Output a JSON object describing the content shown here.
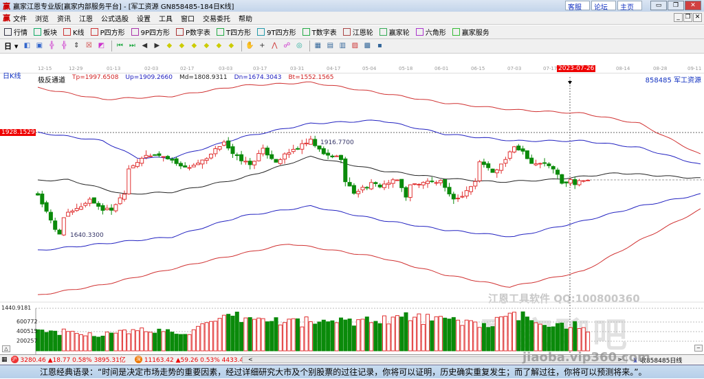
{
  "window": {
    "title": "赢家江恩专业版[赢家内部服务平台] - [军工资源  GN858485-184日K线]",
    "links": [
      "客服",
      "论坛",
      "主页"
    ],
    "logo": "赢"
  },
  "menu": [
    "文件",
    "浏览",
    "资讯",
    "江恩",
    "公式选股",
    "设置",
    "工具",
    "窗口",
    "交易委托",
    "帮助"
  ],
  "toolbar1": [
    {
      "label": "行情",
      "icon": "grid-icon",
      "color": "#334"
    },
    {
      "label": "板块",
      "icon": "blocks-icon",
      "color": "#1a6"
    },
    {
      "label": "K线",
      "icon": "candles-icon",
      "color": "#c33"
    },
    {
      "label": "P四方形",
      "icon": "p-square-icon",
      "color": "#c33"
    },
    {
      "label": "9P四方形",
      "icon": "9p-square-icon",
      "color": "#a3a"
    },
    {
      "label": "P数字表",
      "icon": "p-table-icon",
      "color": "#a33"
    },
    {
      "label": "T四方形",
      "icon": "t-square-icon",
      "color": "#2a4"
    },
    {
      "label": "9T四方形",
      "icon": "9t-square-icon",
      "color": "#29a"
    },
    {
      "label": "T数字表",
      "icon": "t-table-icon",
      "color": "#2a4"
    },
    {
      "label": "江恩轮",
      "icon": "gann-wheel-icon",
      "color": "#a44"
    },
    {
      "label": "赢家轮",
      "icon": "winner-wheel-icon",
      "color": "#3a5"
    },
    {
      "label": "六角形",
      "icon": "hexagon-icon",
      "color": "#a3c"
    },
    {
      "label": "赢家服务",
      "icon": "dollar-icon",
      "color": "#3b3"
    }
  ],
  "toolbar2": {
    "period": "日",
    "buttons": [
      "◧",
      "▣",
      "╬",
      "╬",
      "⇕",
      "☒",
      "◩",
      "⏮",
      "⏭",
      "◀",
      "▶",
      "◆",
      "◆",
      "◆",
      "◆",
      "◆",
      "◆",
      "✋",
      "+",
      "⋀",
      "☍",
      "◎",
      "▦",
      "▤",
      "▥",
      "▨",
      "▩",
      "▪"
    ]
  },
  "axis": {
    "ticks": [
      "12-15",
      "12-29",
      "01-13",
      "02-03",
      "02-17",
      "03-03",
      "03-17",
      "03-31",
      "04-17",
      "05-04",
      "05-18",
      "06-01",
      "06-15",
      "07-03",
      "07-17",
      "2023-07-26",
      "08-14",
      "08-28",
      "09-11"
    ]
  },
  "header": {
    "period": "日K线",
    "indicator": "极反通道",
    "tp": "Tp=1997.6508",
    "up": "Up=1909.2660",
    "md": "Md=1808.9311",
    "dn": "Dn=1674.3043",
    "bt": "Bt=1552.1565",
    "code": "858485  军工资源"
  },
  "labels": {
    "cursor_price": "1928.1529",
    "high": "1916.7700",
    "low": "1640.3300",
    "bottom": "1440.9181",
    "vol": [
      "600772",
      "400515",
      "200257"
    ]
  },
  "watermark": {
    "line1": "江恩工具软件  QQ:100800360",
    "line2": "赢家聊吧",
    "line3": "jiaoba.vip360.com"
  },
  "status": {
    "sh": {
      "badge": "沪",
      "text": "3280.46 ▲18.77 0.58% 3895.31亿"
    },
    "sz": {
      "badge": "深",
      "text": "11163.42 ▲59.26 0.53% 4433.45亿"
    },
    "right": "收858485日线"
  },
  "quote": "江恩经典语录：“时间是决定市场走势的重要因素，经过详细研究大市及个别股票的过往记录，你将可以证明，历史确实重复发生；而了解过往，你将可以预测将来。”。",
  "colors": {
    "up": "#e03030",
    "down": "#0a8a0a",
    "band_outer": "#d03030",
    "band_inner": "#2020c0",
    "mid": "#222222"
  },
  "chart_data": {
    "type": "candlestick",
    "title": "军工资源 日K线",
    "candles": 128,
    "close_keypoints": [
      [
        0,
        1756
      ],
      [
        4,
        1658
      ],
      [
        5,
        1648
      ],
      [
        6,
        1696
      ],
      [
        9,
        1715
      ],
      [
        12,
        1743
      ],
      [
        15,
        1715
      ],
      [
        17,
        1715
      ],
      [
        20,
        1762
      ],
      [
        21,
        1829
      ],
      [
        24,
        1858
      ],
      [
        28,
        1867
      ],
      [
        33,
        1839
      ],
      [
        34,
        1829
      ],
      [
        39,
        1853
      ],
      [
        43,
        1905
      ],
      [
        45,
        1867
      ],
      [
        49,
        1839
      ],
      [
        52,
        1880
      ],
      [
        55,
        1848
      ],
      [
        59,
        1880
      ],
      [
        63,
        1905
      ],
      [
        66,
        1867
      ],
      [
        70,
        1858
      ],
      [
        71,
        1791
      ],
      [
        73,
        1762
      ],
      [
        77,
        1785
      ],
      [
        79,
        1781
      ],
      [
        83,
        1796
      ],
      [
        85,
        1753
      ],
      [
        86,
        1781
      ],
      [
        89,
        1791
      ],
      [
        93,
        1791
      ],
      [
        95,
        1753
      ],
      [
        97,
        1743
      ],
      [
        101,
        1791
      ],
      [
        102,
        1848
      ],
      [
        105,
        1820
      ],
      [
        107,
        1839
      ],
      [
        110,
        1886
      ],
      [
        112,
        1877
      ],
      [
        114,
        1843
      ],
      [
        118,
        1839
      ],
      [
        120,
        1810
      ],
      [
        121,
        1785
      ],
      [
        123,
        1796
      ],
      [
        124,
        1785
      ],
      [
        127,
        1800
      ]
    ],
    "bands": {
      "tp": [
        [
          0,
          2052
        ],
        [
          15,
          2020
        ],
        [
          31,
          2029
        ],
        [
          47,
          2058
        ],
        [
          63,
          2067
        ],
        [
          79,
          2038
        ],
        [
          94,
          2010
        ],
        [
          110,
          1991
        ],
        [
          126,
          1981
        ],
        [
          139,
          1953
        ],
        [
          153,
          1867
        ]
      ],
      "up": [
        [
          0,
          1928
        ],
        [
          15,
          1905
        ],
        [
          23,
          1858
        ],
        [
          31,
          1858
        ],
        [
          47,
          1915
        ],
        [
          63,
          1953
        ],
        [
          79,
          1962
        ],
        [
          94,
          1924
        ],
        [
          110,
          1905
        ],
        [
          126,
          1905
        ],
        [
          139,
          1886
        ],
        [
          153,
          1839
        ]
      ],
      "md": [
        [
          0,
          1795
        ],
        [
          7,
          1797
        ],
        [
          20,
          1757
        ],
        [
          31,
          1763
        ],
        [
          47,
          1801
        ],
        [
          63,
          1861
        ],
        [
          79,
          1823
        ],
        [
          94,
          1801
        ],
        [
          106,
          1791
        ],
        [
          118,
          1797
        ],
        [
          134,
          1816
        ],
        [
          153,
          1801
        ]
      ],
      "dn": [
        [
          0,
          1601
        ],
        [
          15,
          1620
        ],
        [
          31,
          1639
        ],
        [
          47,
          1696
        ],
        [
          63,
          1724
        ],
        [
          79,
          1686
        ],
        [
          94,
          1658
        ],
        [
          110,
          1639
        ],
        [
          126,
          1683
        ],
        [
          139,
          1724
        ],
        [
          153,
          1757
        ]
      ],
      "bt": [
        [
          0,
          1477
        ],
        [
          15,
          1506
        ],
        [
          39,
          1572
        ],
        [
          58,
          1620
        ],
        [
          79,
          1582
        ],
        [
          94,
          1534
        ],
        [
          109,
          1500
        ],
        [
          126,
          1544
        ],
        [
          139,
          1629
        ],
        [
          153,
          1715
        ]
      ]
    },
    "volume_keypoints": [
      [
        0,
        420000
      ],
      [
        15,
        340000
      ],
      [
        25,
        430000
      ],
      [
        35,
        390000
      ],
      [
        45,
        700000
      ],
      [
        55,
        620000
      ],
      [
        65,
        600000
      ],
      [
        75,
        640000
      ],
      [
        85,
        700000
      ],
      [
        95,
        620000
      ],
      [
        105,
        560000
      ],
      [
        110,
        730000
      ],
      [
        118,
        580000
      ],
      [
        124,
        520000
      ],
      [
        127,
        400000
      ]
    ],
    "price_range": [
      1440.9181,
      1928.1529
    ],
    "volume_ticks": [
      200257,
      400515,
      600772
    ]
  }
}
